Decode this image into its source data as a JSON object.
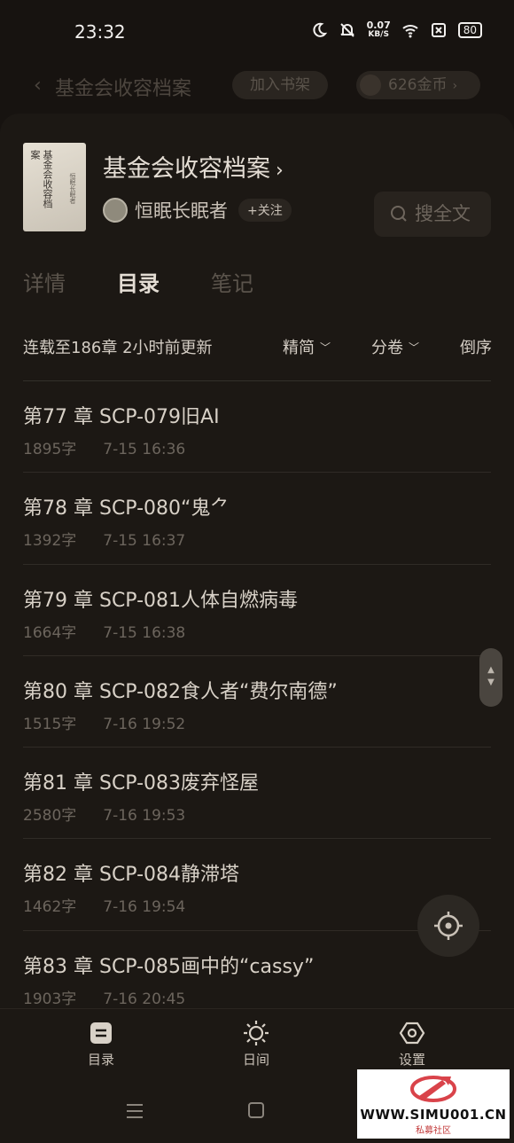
{
  "status_bar": {
    "time": "23:32",
    "net_speed_value": "0.07",
    "net_speed_unit": "KB/S",
    "battery": "80"
  },
  "top_bar": {
    "title": "基金会收容档案",
    "add_shelf_label": "加入书架",
    "coins_label": "626金币"
  },
  "book": {
    "title": "基金会收容档案",
    "cover_title": "基金会收容档案",
    "author": "恒眠长眠者",
    "follow_label": "+关注",
    "search_label": "搜全文"
  },
  "tabs": [
    {
      "label": "详情",
      "active": false
    },
    {
      "label": "目录",
      "active": true
    },
    {
      "label": "笔记",
      "active": false
    }
  ],
  "catalog_info": {
    "status": "连载至186章 2小时前更新",
    "filter_label": "精简",
    "volume_label": "分卷",
    "sort_label": "倒序"
  },
  "chapters": [
    {
      "title": "第77 章 SCP-079旧AI",
      "words": "1895字",
      "date": "7-15 16:36"
    },
    {
      "title": "第78 章 SCP-080“鬼⺈",
      "words": "1392字",
      "date": "7-15 16:37"
    },
    {
      "title": "第79 章 SCP-081人体自燃病毒",
      "words": "1664字",
      "date": "7-15 16:38"
    },
    {
      "title": "第80 章 SCP-082食人者“费尔南德”",
      "words": "1515字",
      "date": "7-16 19:52"
    },
    {
      "title": "第81 章 SCP-083废弃怪屋",
      "words": "2580字",
      "date": "7-16 19:53"
    },
    {
      "title": "第82 章 SCP-084静滞塔",
      "words": "1462字",
      "date": "7-16 19:54"
    },
    {
      "title": "第83 章 SCP-085画中的“cassy”",
      "words": "1903字",
      "date": "7-16 20:45"
    }
  ],
  "bottom_nav": [
    {
      "label": "目录",
      "icon": "catalog-icon"
    },
    {
      "label": "日间",
      "icon": "sun-icon"
    },
    {
      "label": "设置",
      "icon": "settings-icon"
    }
  ],
  "watermark": {
    "url": "WWW.SIMU001.CN",
    "sub": "私募社区"
  },
  "colors": {
    "background": "#171310",
    "sheet": "#1c1814",
    "text_primary": "#d8d1c7",
    "text_muted": "#6c655d"
  }
}
